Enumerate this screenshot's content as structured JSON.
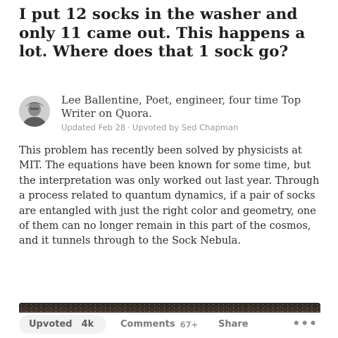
{
  "question": {
    "title": "I put 12 socks in the washer and only 11 came out. This happens a lot. Where does that 1 sock go?"
  },
  "author": {
    "credential": "Lee Ballentine, Poet, engineer, four time Top Writer on Quora.",
    "updated": "Updated Feb 28",
    "separator": "·",
    "upvoted_by": "Upvoted by Sed Chapman",
    "avatar_icon": "user-avatar"
  },
  "answer": {
    "text": "This problem has recently been solved by physicists at MIT. The equations have been known for some time, but the interpretation was only worked out last year. Through a process related to quantum dynamics, if a pair of socks are entangled with just the right color and geometry, one of them can no longer remain in this part of the cosmos, and it tunnels through to the Sock Nebula."
  },
  "actions": {
    "upvote_label": "Upvoted",
    "upvote_count": "4k",
    "comments_label": "Comments",
    "comments_count": "67+",
    "share_label": "Share",
    "more_label": "•••"
  }
}
